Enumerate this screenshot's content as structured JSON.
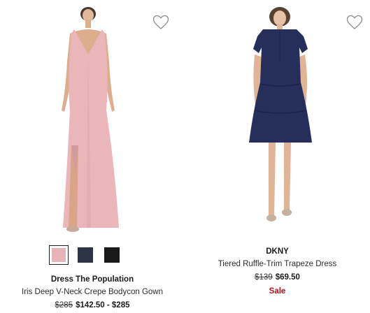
{
  "products": [
    {
      "brand": "Dress The Population",
      "name": "Iris Deep V-Neck Crepe Bodycon Gown",
      "original_price": "$285",
      "sale_price": "$142.50 - $285",
      "image_icon": "pink-gown-image",
      "swatches": [
        {
          "color": "#e8b4b8",
          "selected": true
        },
        {
          "color": "#2c3446",
          "selected": false
        },
        {
          "color": "#1a1a1a",
          "selected": false
        }
      ]
    },
    {
      "brand": "DKNY",
      "name": "Tiered Ruffle-Trim Trapeze Dress",
      "original_price": "$139",
      "sale_price": "$69.50",
      "sale_label": "Sale",
      "image_icon": "navy-dress-image"
    }
  ],
  "colors": {
    "sale_red": "#b0121b",
    "heart_outline": "#8a8a8a"
  }
}
